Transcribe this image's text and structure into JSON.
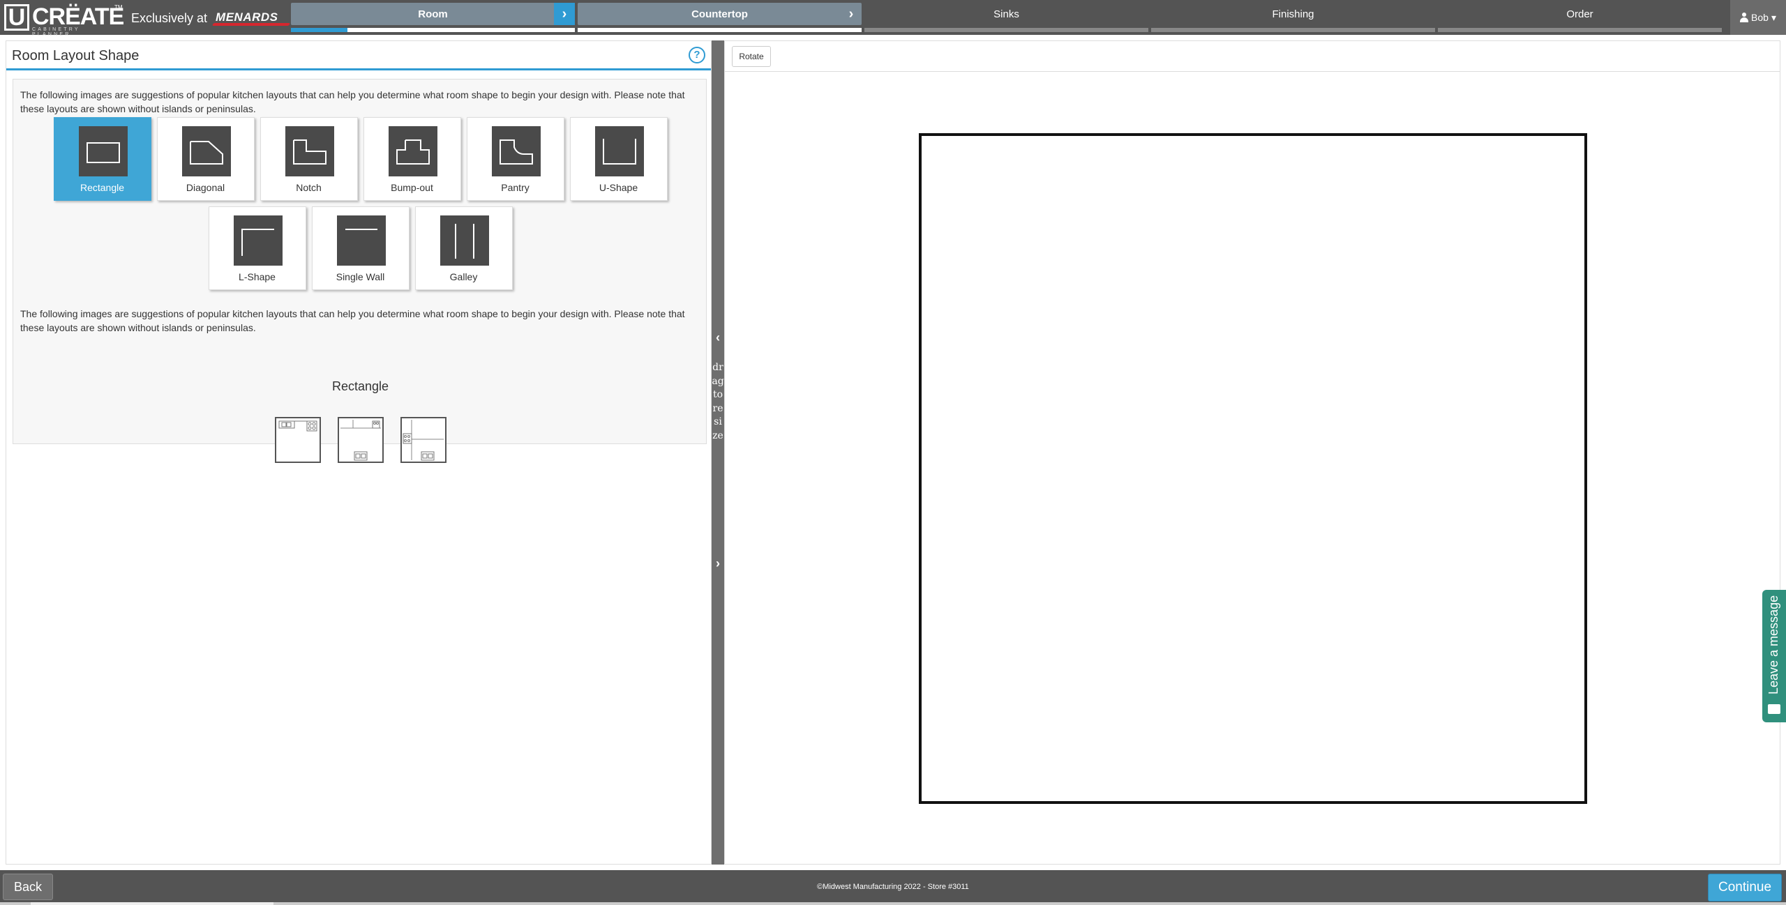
{
  "brand": {
    "logo_text": "CRËATE",
    "logo_letter": "U",
    "logo_sub": "CABINETRY PLANNER",
    "logo_tm": "TM",
    "exclusively": "Exclusively at",
    "retailer": "MENARDS"
  },
  "steps": [
    {
      "label": "Room",
      "state": "done",
      "progress": 0.2
    },
    {
      "label": "Countertop",
      "state": "done",
      "progress": 0
    },
    {
      "label": "Sinks",
      "state": "pending",
      "progress": 0
    },
    {
      "label": "Finishing",
      "state": "pending",
      "progress": 0
    },
    {
      "label": "Order",
      "state": "pending",
      "progress": 0
    }
  ],
  "user": {
    "name": "Bob",
    "caret": "▾"
  },
  "left_panel": {
    "title": "Room Layout Shape",
    "help": "?",
    "description": "The following images are suggestions of popular kitchen layouts that can help you determine what room shape to begin your design with. Please note that these layouts are shown without islands or peninsulas.",
    "shapes_row1": [
      {
        "label": "Rectangle",
        "icon": "rectangle-icon",
        "selected": true
      },
      {
        "label": "Diagonal",
        "icon": "diagonal-icon",
        "selected": false
      },
      {
        "label": "Notch",
        "icon": "notch-icon",
        "selected": false
      },
      {
        "label": "Bump-out",
        "icon": "bump-out-icon",
        "selected": false
      },
      {
        "label": "Pantry",
        "icon": "pantry-icon",
        "selected": false
      },
      {
        "label": "U-Shape",
        "icon": "u-shape-icon",
        "selected": false
      }
    ],
    "shapes_row2": [
      {
        "label": "L-Shape",
        "icon": "l-shape-icon",
        "selected": false
      },
      {
        "label": "Single Wall",
        "icon": "single-wall-icon",
        "selected": false
      },
      {
        "label": "Galley",
        "icon": "galley-icon",
        "selected": false
      }
    ],
    "description2": "The following images are suggestions of popular kitchen layouts that can help you determine what room shape to begin your design with. Please note that these layouts are shown without islands or peninsulas.",
    "selected_shape": "Rectangle"
  },
  "splitter": {
    "drag_text": "drag to resize",
    "left_arrow": "‹",
    "right_arrow": "›"
  },
  "right_panel": {
    "rotate_label": "Rotate"
  },
  "leave_message": "Leave a message",
  "footer": {
    "back": "Back",
    "copyright": "©Midwest Manufacturing 2022 - Store #3011",
    "continue": "Continue"
  },
  "colors": {
    "accent": "#2f9bd3",
    "bar": "#545454",
    "chat": "#30907d"
  }
}
